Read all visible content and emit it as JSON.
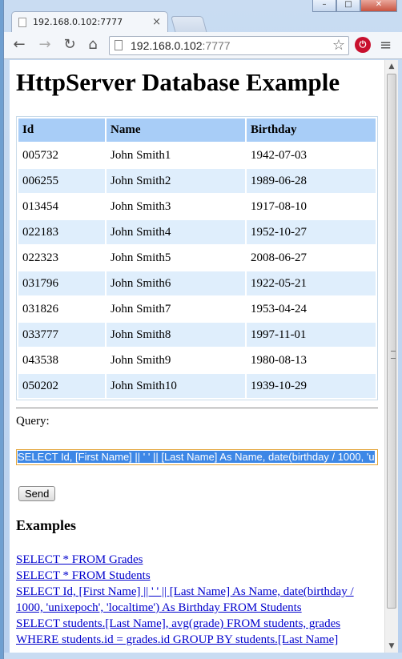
{
  "browser": {
    "tab_title": "192.168.0.102:7777",
    "address_host": "192.168.0.102",
    "address_port": ":7777",
    "window_controls": [
      "–",
      "□",
      "✕"
    ]
  },
  "page": {
    "heading": "HttpServer Database Example",
    "table": {
      "headers": [
        "Id",
        "Name",
        "Birthday"
      ],
      "rows": [
        [
          "005732",
          "John Smith1",
          "1942-07-03"
        ],
        [
          "006255",
          "John Smith2",
          "1989-06-28"
        ],
        [
          "013454",
          "John Smith3",
          "1917-08-10"
        ],
        [
          "022183",
          "John Smith4",
          "1952-10-27"
        ],
        [
          "022323",
          "John Smith5",
          "2008-06-27"
        ],
        [
          "031796",
          "John Smith6",
          "1922-05-21"
        ],
        [
          "031826",
          "John Smith7",
          "1953-04-24"
        ],
        [
          "033777",
          "John Smith8",
          "1997-11-01"
        ],
        [
          "043538",
          "John Smith9",
          "1980-08-13"
        ],
        [
          "050202",
          "John Smith10",
          "1939-10-29"
        ]
      ]
    },
    "query_label": "Query:",
    "query_value": "SELECT Id, [First Name] || ' ' || [Last Name] As Name, date(birthday / 1000, 'u",
    "send_label": "Send",
    "examples_heading": "Examples",
    "examples": [
      "SELECT * FROM Grades",
      "SELECT * FROM Students",
      "SELECT Id, [First Name] || ' ' || [Last Name] As Name, date(birthday / 1000, 'unixepoch', 'localtime') As Birthday FROM Students",
      "SELECT students.[Last Name], avg(grade) FROM students, grades WHERE students.id = grades.id GROUP BY students.[Last Name]"
    ]
  }
}
